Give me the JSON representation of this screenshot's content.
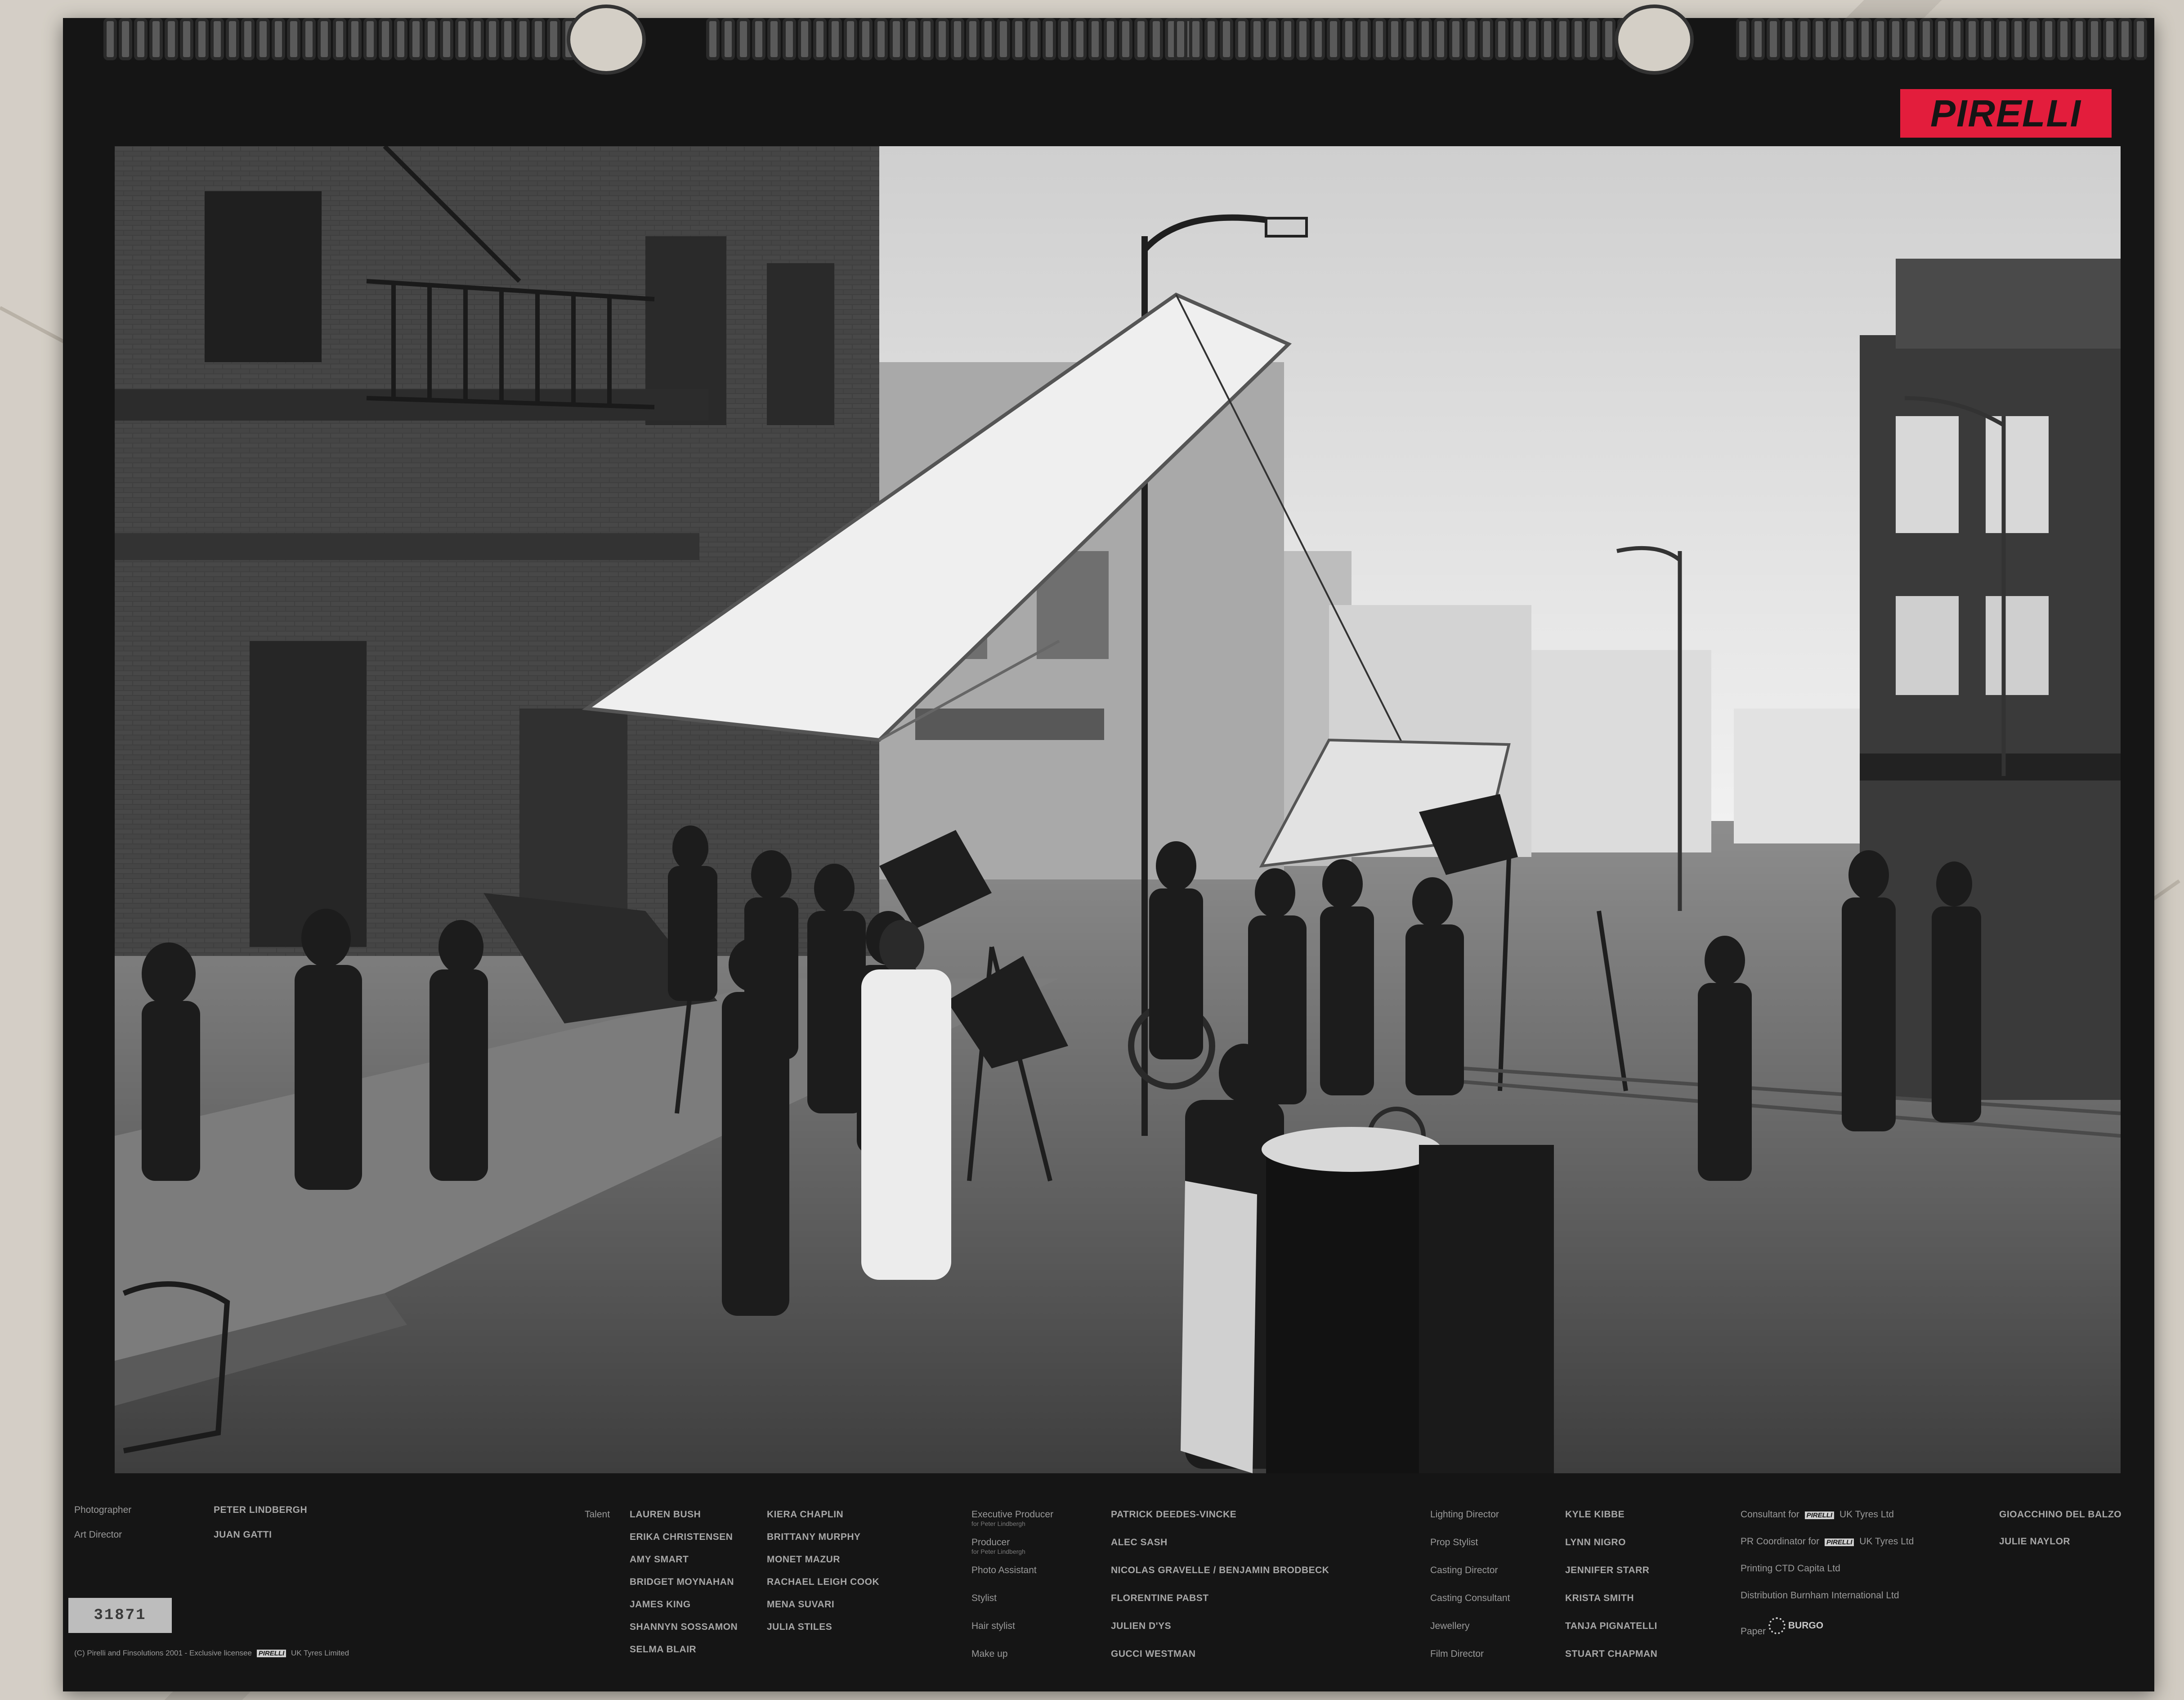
{
  "brand": {
    "logo": "PIRELLI",
    "logo_color": "#e31d3c"
  },
  "serial": "31871",
  "credits_left": {
    "photographer_label": "Photographer",
    "photographer": "PETER LINDBERGH",
    "art_director_label": "Art Director",
    "art_director": "JUAN GATTI"
  },
  "talent": {
    "label": "Talent",
    "col1": [
      "LAUREN BUSH",
      "ERIKA CHRISTENSEN",
      "AMY SMART",
      "BRIDGET MOYNAHAN",
      "JAMES KING",
      "SHANNYN SOSSAMON",
      "SELMA BLAIR"
    ],
    "col2": [
      "KIERA CHAPLIN",
      "BRITTANY MURPHY",
      "MONET MAZUR",
      "RACHAEL LEIGH COOK",
      "MENA SUVARI",
      "JULIA STILES"
    ]
  },
  "production": [
    {
      "label": "Executive Producer",
      "sub": "for Peter Lindbergh",
      "name": "PATRICK DEEDES-VINCKE"
    },
    {
      "label": "Producer",
      "sub": "for Peter Lindbergh",
      "name": "ALEC SASH"
    },
    {
      "label": "Photo Assistant",
      "sub": "",
      "name": "NICOLAS GRAVELLE / BENJAMIN BRODBECK"
    },
    {
      "label": "Stylist",
      "sub": "",
      "name": "FLORENTINE PABST"
    },
    {
      "label": "Hair stylist",
      "sub": "",
      "name": "JULIEN D'YS"
    },
    {
      "label": "Make up",
      "sub": "",
      "name": "GUCCI WESTMAN"
    }
  ],
  "crew": [
    {
      "label": "Lighting Director",
      "name": "KYLE KIBBE"
    },
    {
      "label": "Prop Stylist",
      "name": "LYNN NIGRO"
    },
    {
      "label": "Casting Director",
      "name": "JENNIFER STARR"
    },
    {
      "label": "Casting Consultant",
      "name": "KRISTA SMITH"
    },
    {
      "label": "Jewellery",
      "name": "TANJA PIGNATELLI"
    },
    {
      "label": "Film Director",
      "name": "STUART CHAPMAN"
    }
  ],
  "consultants": {
    "consultant_pre": "Consultant for",
    "consultant_post": "UK Tyres Ltd",
    "consultant_name": "GIOACCHINO DEL BALZO",
    "pr_pre": "PR Coordinator for",
    "pr_post": "UK Tyres Ltd",
    "pr_name": "JULIE NAYLOR",
    "printing": "Printing CTD Capita Ltd",
    "distribution": "Distribution Burnham International Ltd",
    "paper_label": "Paper",
    "paper_brand": "BURGO",
    "mini_logo": "PIRELLI"
  },
  "copyright": {
    "pre": "(C) Pirelli and Finsolutions 2001 - Exclusive licensee",
    "post": "UK Tyres Limited"
  }
}
